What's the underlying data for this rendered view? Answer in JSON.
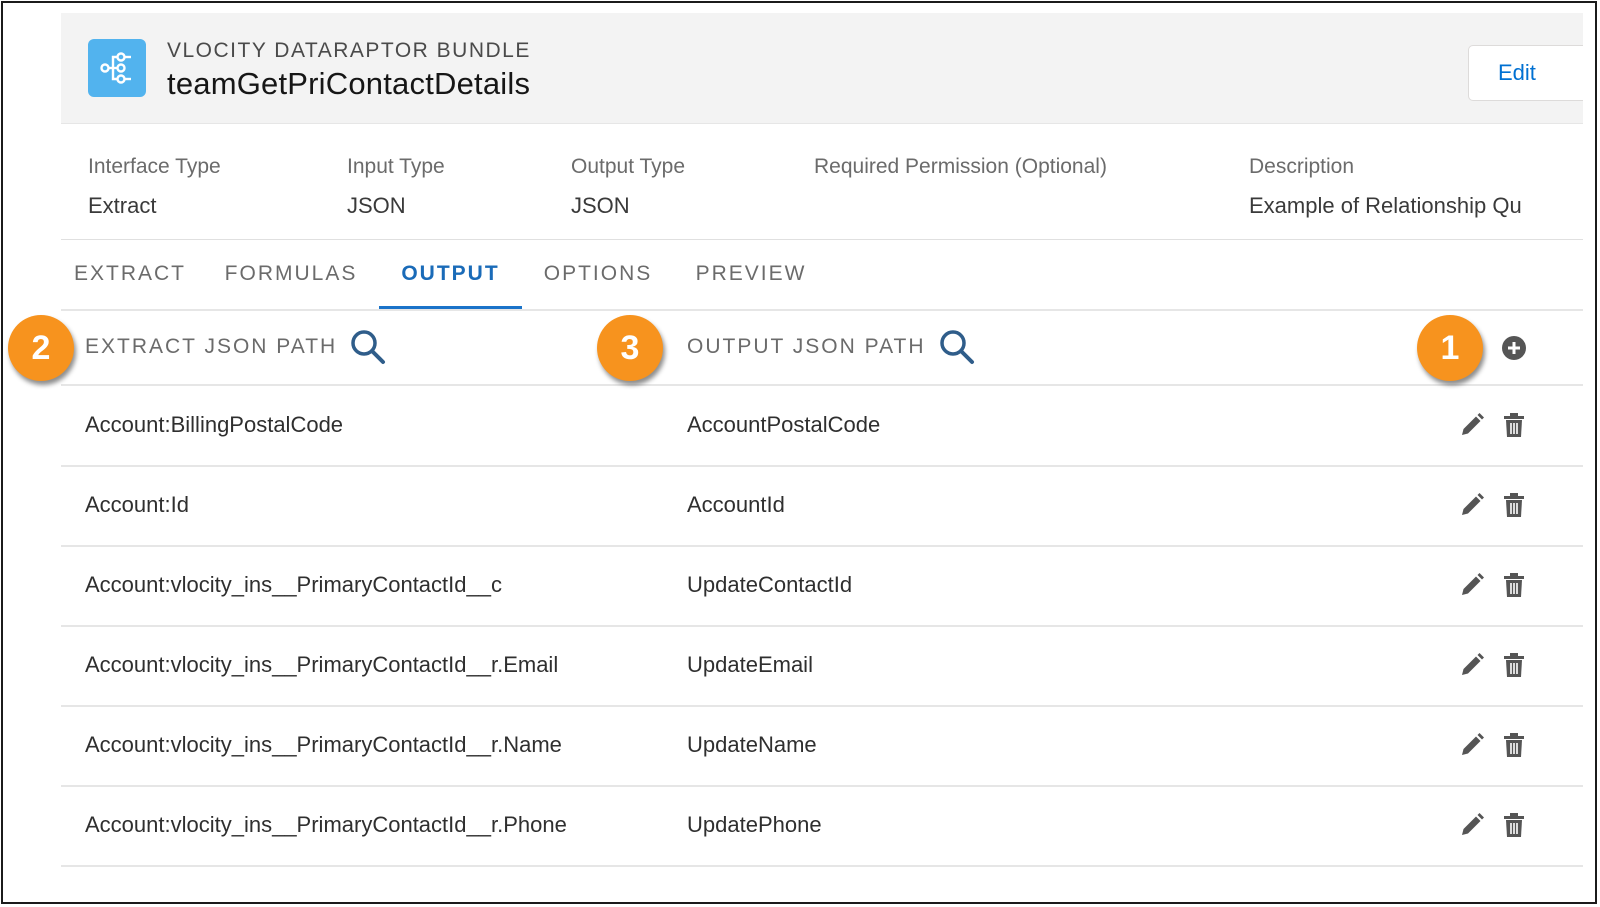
{
  "header": {
    "eyebrow": "VLOCITY DATARAPTOR BUNDLE",
    "title": "teamGetPriContactDetails",
    "edit_label": "Edit"
  },
  "details": [
    {
      "label": "Interface Type",
      "value": "Extract"
    },
    {
      "label": "Input Type",
      "value": "JSON"
    },
    {
      "label": "Output Type",
      "value": "JSON"
    },
    {
      "label": "Required Permission (Optional)",
      "value": ""
    },
    {
      "label": "Description",
      "value": "Example of Relationship Qu"
    }
  ],
  "tabs": [
    {
      "label": "EXTRACT"
    },
    {
      "label": "FORMULAS"
    },
    {
      "label": "OUTPUT"
    },
    {
      "label": "OPTIONS"
    },
    {
      "label": "PREVIEW"
    }
  ],
  "active_tab": "OUTPUT",
  "table": {
    "columns": [
      "EXTRACT JSON PATH",
      "OUTPUT JSON PATH"
    ],
    "rows": [
      {
        "extract": "Account:BillingPostalCode",
        "output": "AccountPostalCode"
      },
      {
        "extract": "Account:Id",
        "output": "AccountId"
      },
      {
        "extract": "Account:vlocity_ins__PrimaryContactId__c",
        "output": "UpdateContactId"
      },
      {
        "extract": "Account:vlocity_ins__PrimaryContactId__r.Email",
        "output": "UpdateEmail"
      },
      {
        "extract": "Account:vlocity_ins__PrimaryContactId__r.Name",
        "output": "UpdateName"
      },
      {
        "extract": "Account:vlocity_ins__PrimaryContactId__r.Phone",
        "output": "UpdatePhone"
      }
    ]
  },
  "callouts": [
    "1",
    "2",
    "3"
  ],
  "icons": {
    "app": "dataraptor-icon",
    "search": "search-icon",
    "add": "add-circle-icon",
    "edit": "pencil-icon",
    "delete": "trash-icon"
  },
  "colors": {
    "accent": "#0070d2",
    "callout": "#f7931e",
    "app_icon": "#52b3ee"
  }
}
